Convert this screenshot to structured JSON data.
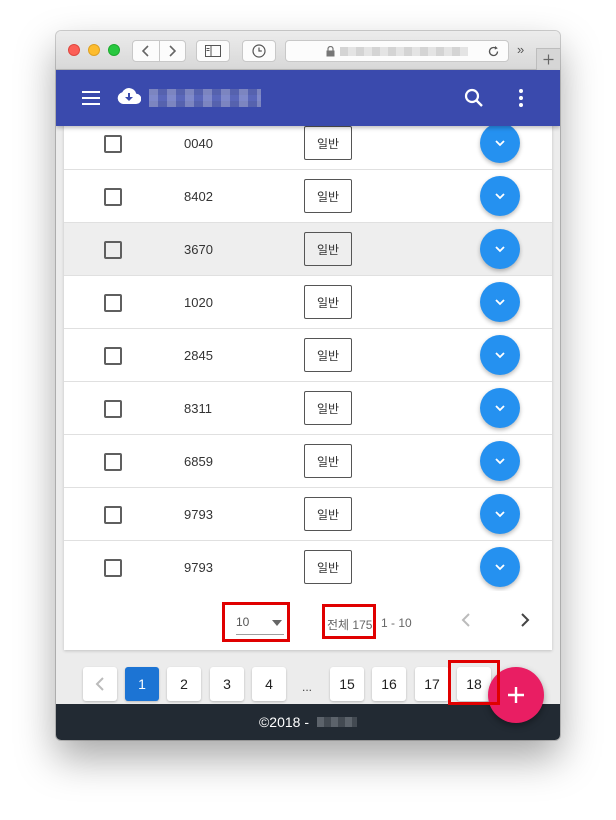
{
  "browser": {
    "nav_more": "»",
    "new_tab": "+"
  },
  "table": {
    "rows": [
      {
        "id": "0040",
        "tag": "일반",
        "highlight": false
      },
      {
        "id": "8402",
        "tag": "일반",
        "highlight": false
      },
      {
        "id": "3670",
        "tag": "일반",
        "highlight": true
      },
      {
        "id": "1020",
        "tag": "일반",
        "highlight": false
      },
      {
        "id": "2845",
        "tag": "일반",
        "highlight": false
      },
      {
        "id": "8311",
        "tag": "일반",
        "highlight": false
      },
      {
        "id": "6859",
        "tag": "일반",
        "highlight": false
      },
      {
        "id": "9793",
        "tag": "일반",
        "highlight": false
      },
      {
        "id": "9793",
        "tag": "일반",
        "highlight": false
      }
    ]
  },
  "table_pager": {
    "rows_per_page": "10",
    "total_label": "전체 175",
    "range_label": "1 - 10"
  },
  "pagination": {
    "pages": [
      "1",
      "2",
      "3",
      "4",
      "...",
      "15",
      "16",
      "17",
      "18"
    ],
    "active_page": "1"
  },
  "footer": {
    "copyright": "©2018 -"
  },
  "colors": {
    "appbar": "#3a4aad",
    "row_fab": "#2591f0",
    "active_page": "#1c74d4",
    "main_fab": "#e91e63",
    "footer": "#222a33",
    "annotation": "#e00000"
  },
  "icons": {
    "menu": "hamburger-menu-icon",
    "logo": "cloud-download-icon",
    "search": "search-icon",
    "more": "more-vert-icon",
    "row_action": "chevron-down-icon",
    "add": "plus-icon"
  }
}
